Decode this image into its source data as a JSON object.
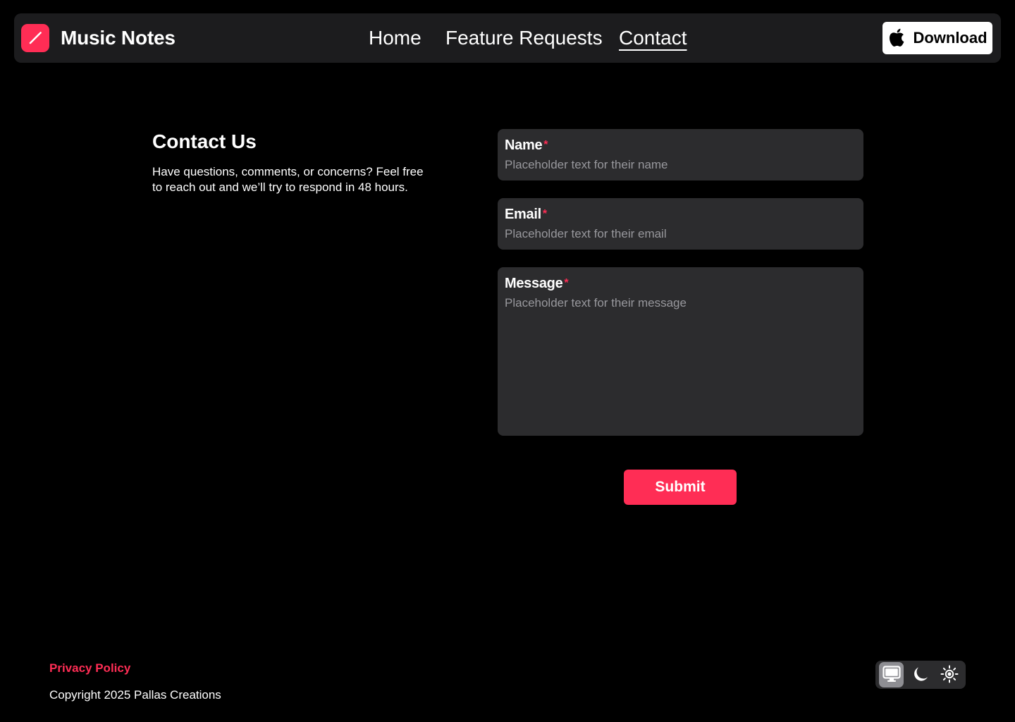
{
  "header": {
    "brand_name": "Music Notes",
    "nav": [
      {
        "label": "Home",
        "active": false
      },
      {
        "label": "Feature Requests",
        "active": false
      },
      {
        "label": "Contact",
        "active": true
      }
    ],
    "download_label": "Download"
  },
  "intro": {
    "title": "Contact Us",
    "text": "Have questions, comments, or concerns? Feel free to reach out and we’ll try to respond in 48 hours."
  },
  "form": {
    "required_mark": "*",
    "name": {
      "label": "Name",
      "placeholder": "Placeholder text for their name",
      "value": ""
    },
    "email": {
      "label": "Email",
      "placeholder": "Placeholder text for their email",
      "value": ""
    },
    "message": {
      "label": "Message",
      "placeholder": "Placeholder text for their message",
      "value": ""
    },
    "submit_label": "Submit"
  },
  "footer": {
    "privacy_label": "Privacy Policy",
    "copyright": "Copyright 2025 Pallas Creations",
    "theme_options": [
      {
        "icon": "monitor-icon",
        "active": true
      },
      {
        "icon": "moon-icon",
        "active": false
      },
      {
        "icon": "sun-icon",
        "active": false
      }
    ]
  },
  "colors": {
    "accent": "#ff2d55",
    "background": "#000000",
    "surface": "#1c1c1e",
    "field": "#2c2c2e",
    "placeholder": "#98989d"
  }
}
